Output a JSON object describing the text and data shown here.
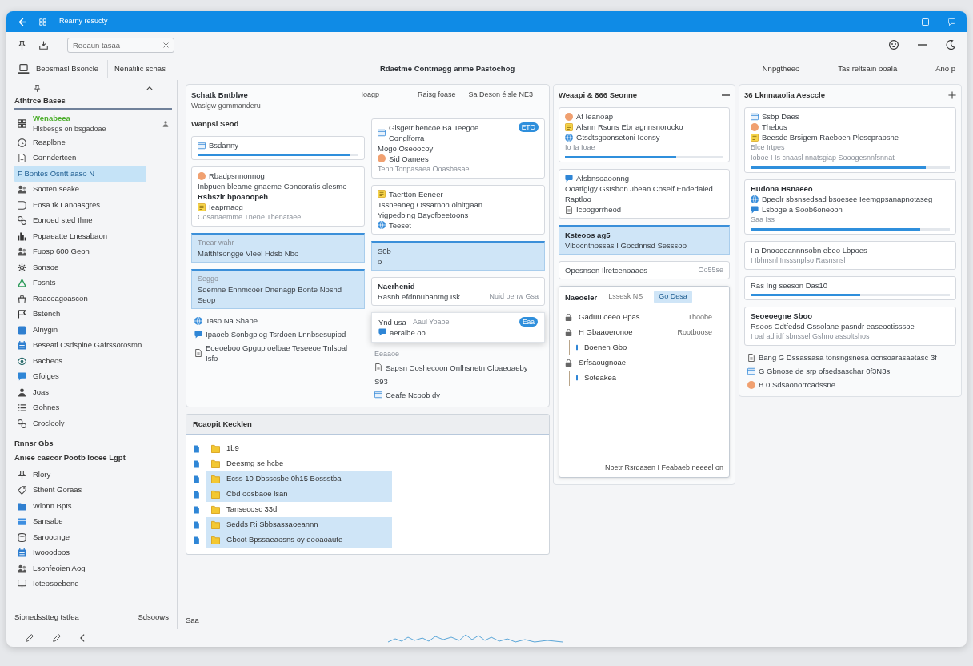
{
  "window": {
    "title": "Rearny resucty"
  },
  "toolbar": {
    "search": {
      "placeholder": "Reoaun tasaa"
    }
  },
  "header": {
    "device": "Beosmasl Bsoncle",
    "filter": "Nenatilic schas",
    "title": "Rdaetme Contmagg anme Pastochog",
    "links": [
      "Nnpgtheeo",
      "Tas reltsain ooala",
      "Ano p"
    ]
  },
  "sidebar": {
    "title": "Athtrce Bases",
    "items": [
      {
        "label": "Wenabeea",
        "sublabel": "Hlsbesgs on bsgadoae",
        "color": "#4cae2c",
        "selected": false
      },
      {
        "label": "Reaplbne",
        "selected": false
      },
      {
        "label": "Conndertcen",
        "selected": false
      },
      {
        "label": "F Bontes Osntt aaso N",
        "selected": true
      },
      {
        "label": "Sooten seake",
        "selected": false
      },
      {
        "label": "Eosa.tk Lanoasgres",
        "selected": false
      },
      {
        "label": "Eonoed sted Ihne",
        "selected": false
      },
      {
        "label": "Popaeatte Lnesabaon",
        "selected": false
      },
      {
        "label": "Fuosp 600 Geon",
        "selected": false
      },
      {
        "label": "Sonsoe",
        "selected": false
      },
      {
        "label": "Fosnts",
        "selected": false
      },
      {
        "label": "Roacoagoascon",
        "selected": false
      },
      {
        "label": "Bstench",
        "selected": false
      },
      {
        "label": "Alnygin",
        "selected": false
      },
      {
        "label": "Beseatl Csdspine Gafrssorosmn",
        "selected": false
      },
      {
        "label": "Bacheos",
        "selected": false
      },
      {
        "label": "Gfoiges",
        "selected": false
      },
      {
        "label": "Joas",
        "selected": false
      },
      {
        "label": "Gohnes",
        "selected": false
      },
      {
        "label": "Croclooly",
        "selected": false
      }
    ],
    "section": {
      "title": "Rnnsr Gbs",
      "subtitle": "Aniee cascor Pootb Iocee Lgpt",
      "items": [
        {
          "label": "Rlory"
        },
        {
          "label": "Sthent Goraas"
        },
        {
          "label": "Wlonn Bpts"
        },
        {
          "label": "Sansabe"
        },
        {
          "label": "Saroocnge"
        },
        {
          "label": "Iwooodoos"
        },
        {
          "label": "Lsonfeoien Aog"
        },
        {
          "label": "Ioteosoebene"
        }
      ]
    },
    "footer": {
      "label": "Sipnedsstteg tstfea",
      "value": "Sdsoows"
    }
  },
  "board": {
    "title": "Schatk Bntblwe",
    "subtitle": "Waslgw gommanderu",
    "meta": [
      "Ioagp",
      "Raisg foase",
      "Sa Deson élsle NE3"
    ],
    "columns": [
      [
        {
          "kind": "label",
          "text": "Wanpsl Seod"
        },
        {
          "kind": "card",
          "lines": [
            {
              "kind": "icon",
              "text": "Bsdanny"
            }
          ],
          "level": 0.95
        },
        {
          "kind": "card",
          "lines": [
            {
              "kind": "icon",
              "text": "Rbadpsnnonnog"
            },
            {
              "kind": "text",
              "text": "Inbpuen bleame gnaeme Concoratis olesmo"
            },
            {
              "kind": "title",
              "text": "Rsbszlr bpoaoopeh"
            },
            {
              "kind": "icon",
              "text": "Ieaprnaog"
            },
            {
              "kind": "muted",
              "text": "Cosanaemme Tnene Thenataee"
            }
          ]
        },
        {
          "kind": "band",
          "lines": [
            {
              "kind": "muted",
              "text": "Tnear wahr"
            },
            {
              "kind": "text",
              "text": "Matthfsongge Vleel Hdsb Nbo"
            }
          ]
        },
        {
          "kind": "band",
          "lines": [
            {
              "kind": "muted",
              "text": "Seggo"
            },
            {
              "kind": "text",
              "text": "Sdemne Ennmcoer Dnenagp Bonte Nosnd"
            },
            {
              "kind": "text",
              "text": "Seop"
            }
          ]
        },
        {
          "kind": "list",
          "lines": [
            {
              "kind": "icon",
              "text": "Taso Na Shaoe"
            },
            {
              "kind": "icon",
              "text": "Ipaoeb Sonbgplog Tsrdoen Lnnbsesupiod"
            },
            {
              "kind": "icon",
              "text": "Eoeoeboo Gpgup oelbae Teseeoe Tnlspal Isfo"
            }
          ]
        }
      ],
      [
        {
          "kind": "card",
          "badge": "ETO",
          "lines": [
            {
              "kind": "icon",
              "text": "Glsgetr bencoe Ba Teegoe Conglforra"
            },
            {
              "kind": "text",
              "text": "Mogo Oseoocoy"
            },
            {
              "kind": "icon",
              "text": "Sid Oanees"
            },
            {
              "kind": "muted",
              "text": "Tenp Tonpasaea Ooasbasae"
            }
          ]
        },
        {
          "kind": "card",
          "lines": [
            {
              "kind": "icon",
              "text": "Taertton Eeneer"
            },
            {
              "kind": "text",
              "text": "Tssneaneg Ossarnon olnitgaan"
            },
            {
              "kind": "text",
              "text": "Yigpedbing Bayofbeetoons"
            },
            {
              "kind": "icon",
              "text": "Teeset"
            }
          ]
        },
        {
          "kind": "band",
          "lines": [
            {
              "kind": "text",
              "text": "S0b"
            },
            {
              "kind": "text",
              "text": "o"
            }
          ]
        },
        {
          "kind": "card",
          "lines": [
            {
              "kind": "title",
              "text": "Naerhenid"
            },
            {
              "kind": "pair",
              "text": "Rasnh efdnnubantng Isk",
              "value": "Nuid benw Gsa"
            }
          ]
        },
        {
          "kind": "popup",
          "badge": "Eaa",
          "lines": [
            {
              "kind": "pair",
              "text": "Ynd usa",
              "value": "Aaul Ypabe"
            },
            {
              "kind": "icon",
              "text": "aeraibe ob"
            }
          ]
        },
        {
          "kind": "list",
          "lines": [
            {
              "kind": "muted",
              "text": "Eeaaoe"
            },
            {
              "kind": "icon",
              "text": "Sapsn Coshecoon Onfhsnetn Cloaeoaeby"
            },
            {
              "kind": "text",
              "text": "S93"
            },
            {
              "kind": "icon",
              "text": "Ceafe Ncoob dy"
            }
          ]
        }
      ]
    ]
  },
  "recent": {
    "title": "Rcaopit Kecklen",
    "items": [
      {
        "label": "1b9",
        "selected": false
      },
      {
        "label": "Deesmg se hcbe",
        "selected": false
      },
      {
        "label": "Ecss 10 Dbsscsbe 0h15 Bossstba",
        "selected": true
      },
      {
        "label": "Cbd oosbaoe lsan",
        "selected": true
      },
      {
        "label": "Tansecosc 33d",
        "selected": false
      },
      {
        "label": "Sedds Ri Sbbsassaoeannn",
        "selected": true
      },
      {
        "label": "Gbcot Bpssaeaosns oy eooaoaute",
        "selected": true
      }
    ]
  },
  "lanes": [
    {
      "title": "Weaapi & 866 Seonne",
      "blocks": [
        {
          "kind": "card",
          "lines": [
            {
              "kind": "icon",
              "text": "Af Ieanoap"
            },
            {
              "kind": "icon",
              "text": "Afsnn Rsuns Ebr agnnsnorocko"
            },
            {
              "kind": "icon",
              "text": "Gtsdtsgoonsetoni Ioonsy"
            },
            {
              "kind": "muted",
              "text": "Io Ia Ioae"
            }
          ],
          "level": 0.7
        },
        {
          "kind": "card",
          "lines": [
            {
              "kind": "icon",
              "text": "Afsbnsoaoonng"
            },
            {
              "kind": "text",
              "text": "Ooatfgigy Gstsbon Jbean Coseif Endedaied"
            },
            {
              "kind": "text",
              "text": "Raptloo"
            },
            {
              "kind": "icon",
              "text": "Icpogorrheod"
            }
          ]
        },
        {
          "kind": "band",
          "lines": [
            {
              "kind": "title",
              "text": "Ksteoos ag5"
            },
            {
              "kind": "text",
              "text": "Vibocntnossas I Gocdnnsd Sesssoo"
            }
          ]
        },
        {
          "kind": "pair",
          "text": "Opesnsen Ilretcenoaaes",
          "value": "Oo55se"
        },
        {
          "kind": "tree",
          "title": "Naeoeler",
          "tabs": [
            {
              "label": "Lssesk NS",
              "selected": false
            },
            {
              "label": "Go Desa",
              "selected": true
            }
          ],
          "items": [
            {
              "label": "Gaduu oeeo Ppas",
              "value": "Thoobe"
            },
            {
              "label": "H Gbaaoeronoe",
              "value": "Rootboose",
              "children": [
                {
                  "label": "Boenen Gbo"
                }
              ]
            },
            {
              "label": "Srfsaougnoae",
              "children": [
                {
                  "label": "Soteakea"
                }
              ]
            }
          ],
          "footer": "Nbetr Rsrdasen I Feabaeb neeeel on"
        }
      ]
    },
    {
      "title": "36 Lknnaaolia Aesccle",
      "blocks": [
        {
          "kind": "card",
          "lines": [
            {
              "kind": "icon",
              "text": "Ssbp Daes"
            },
            {
              "kind": "icon",
              "text": "Thebos"
            },
            {
              "kind": "icon",
              "text": "Beesde Brsigem Raeboen Plescprapsne"
            },
            {
              "kind": "muted",
              "text": "Blce Irtpes"
            },
            {
              "kind": "muted",
              "text": "Ioboe I Is cnaasl nnatsgiap Sooogesnnfsnnat"
            }
          ],
          "level": 0.88
        },
        {
          "kind": "card",
          "lines": [
            {
              "kind": "title",
              "text": "Hudona Hsnaeeo"
            },
            {
              "kind": "icon",
              "text": "Bpeolr sbsnsedsad bsoesee Ieemgpsanapnotaseg"
            },
            {
              "kind": "icon",
              "text": "Lsboge a Soob6oneoon"
            },
            {
              "kind": "muted",
              "text": "Saa Iss"
            }
          ],
          "level": 0.85
        },
        {
          "kind": "card",
          "lines": [
            {
              "kind": "text",
              "text": "I a Dnooeeannnsobn ebeo Lbpoes"
            },
            {
              "kind": "muted",
              "text": "I Ibhnsnl Insssnplso Rasnsnsl"
            }
          ]
        },
        {
          "kind": "card",
          "lines": [
            {
              "kind": "text",
              "text": "Ras Ing seeson Das10"
            }
          ],
          "level": 0.55
        },
        {
          "kind": "card",
          "lines": [
            {
              "kind": "title",
              "text": "Seoeoegne Sboo"
            },
            {
              "kind": "text",
              "text": "Rsoos Cdtfedsd Gssolane pasndr easeoctisssoe"
            },
            {
              "kind": "muted",
              "text": "I oal ad idf sbnssel Gshno assoltshos"
            }
          ]
        },
        {
          "kind": "list",
          "lines": [
            {
              "kind": "icon",
              "text": "Bang G Dssassasa tonsngsnesa ocnsoarasaetasc 3f"
            },
            {
              "kind": "icon",
              "text": "G Gbnose de srp ofsedsaschar 0f3N3s"
            },
            {
              "kind": "icon",
              "text": "B 0 Sdsaonorrcadssne"
            }
          ]
        }
      ]
    }
  ],
  "status_bar": {
    "text": "Saa"
  }
}
